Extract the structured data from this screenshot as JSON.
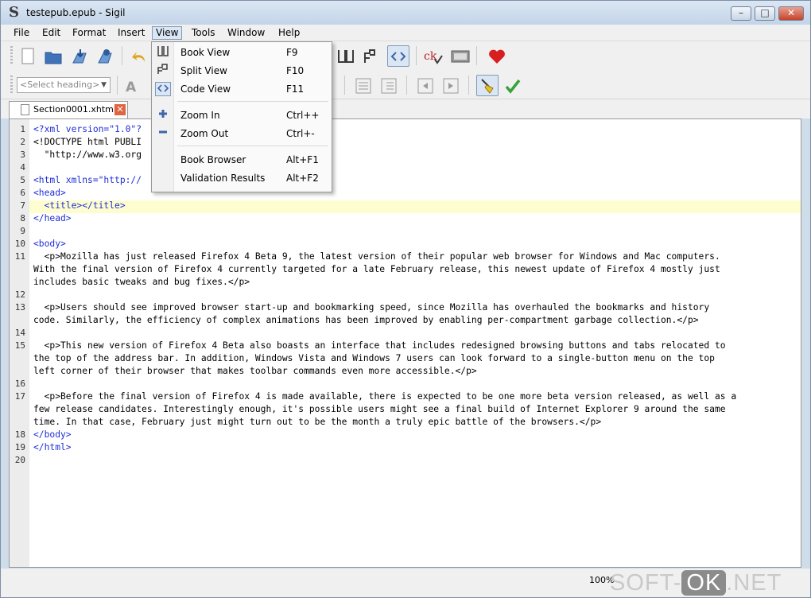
{
  "window": {
    "title": "testepub.epub - Sigil",
    "logo": "S",
    "minimize": "–",
    "maximize": "□",
    "close": "✕"
  },
  "menubar": {
    "items": [
      "File",
      "Edit",
      "Format",
      "Insert",
      "View",
      "Tools",
      "Window",
      "Help"
    ],
    "active": "View"
  },
  "toolbar": {
    "heading_placeholder": "<Select heading>"
  },
  "tab": {
    "label": "Section0001.xhtml",
    "close": "✕"
  },
  "view_menu": {
    "items": [
      {
        "label": "Book View",
        "shortcut": "F9",
        "icon": "book-icon"
      },
      {
        "label": "Split View",
        "shortcut": "F10",
        "icon": "split-icon"
      },
      {
        "label": "Code View",
        "shortcut": "F11",
        "icon": "code-icon",
        "checked": true
      },
      {
        "label": "Zoom In",
        "shortcut": "Ctrl++",
        "icon": "zoom-in-icon"
      },
      {
        "label": "Zoom Out",
        "shortcut": "Ctrl+-",
        "icon": "zoom-out-icon"
      },
      {
        "label": "Book Browser",
        "shortcut": "Alt+F1",
        "icon": ""
      },
      {
        "label": "Validation Results",
        "shortcut": "Alt+F2",
        "icon": ""
      }
    ]
  },
  "editor": {
    "line_numbers": [
      "1",
      "2",
      "3",
      "4",
      "5",
      "6",
      "7",
      "8",
      "9",
      "10",
      "11",
      "12",
      "13",
      "14",
      "15",
      "16",
      "17",
      "18",
      "19",
      "20"
    ],
    "code": {
      "l1": "<?xml version=\"1.0\"?",
      "l2": "<!DOCTYPE html PUBLI",
      "l3": "  \"http://www.w3.org",
      "l5": "<html xmlns=\"http://",
      "l6": "<head>",
      "l7": "  <title></title>",
      "l8": "</head>",
      "l10": "<body>",
      "l11a": "  <p>Mozilla has just released Firefox 4 Beta 9, the latest version of their popular web browser for Windows and Mac computers.",
      "l11b": "With the final version of Firefox 4 currently targeted for a late February release, this newest update of Firefox 4 mostly just",
      "l11c": "includes basic tweaks and bug fixes.</p>",
      "l13a": "  <p>Users should see improved browser start-up and bookmarking speed, since Mozilla has overhauled the bookmarks and history",
      "l13b": "code. Similarly, the efficiency of complex animations has been improved by enabling per-compartment garbage collection.</p>",
      "l15a": "  <p>This new version of Firefox 4 Beta also boasts an interface that includes redesigned browsing buttons and tabs relocated to",
      "l15b": "the top of the address bar. In addition, Windows Vista and Windows 7 users can look forward to a single-button menu on the top",
      "l15c": "left corner of their browser that makes toolbar commands even more accessible.</p>",
      "l17a": "  <p>Before the final version of Firefox 4 is made available, there is expected to be one more beta version released, as well as a",
      "l17b": "few release candidates. Interestingly enough, it's possible users might see a final build of Internet Explorer 9 around the same",
      "l17c": "time. In that case, February just might turn out to be the month a truly epic battle of the browsers.</p>",
      "l18": "</body>",
      "l19": "</html>"
    }
  },
  "status": {
    "zoom": "100%",
    "watermark_left": "SOFT-",
    "watermark_ok": "OK",
    "watermark_right": ".NET"
  }
}
